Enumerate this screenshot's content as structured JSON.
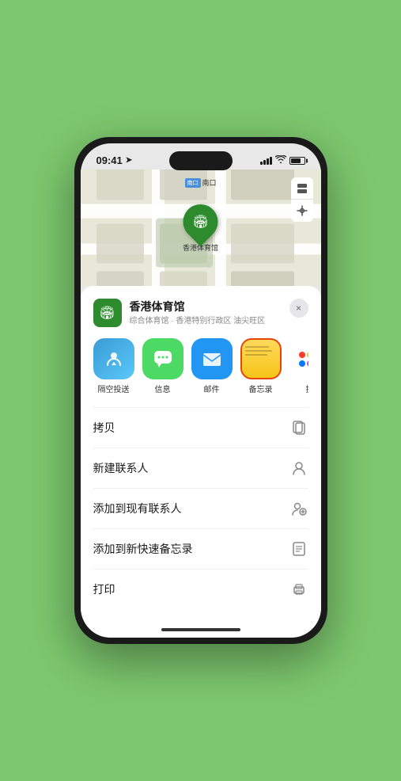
{
  "status_bar": {
    "time": "09:41",
    "location_arrow": "▲"
  },
  "map": {
    "entrance_tag": "南口",
    "pin_label": "香港体育馆"
  },
  "venue": {
    "name": "香港体育馆",
    "subtitle": "综合体育馆 · 香港特别行政区 油尖旺区",
    "close_label": "×"
  },
  "share_items": [
    {
      "id": "airdrop",
      "label": "隔空投送",
      "type": "airdrop"
    },
    {
      "id": "messages",
      "label": "信息",
      "type": "messages"
    },
    {
      "id": "mail",
      "label": "邮件",
      "type": "mail"
    },
    {
      "id": "notes",
      "label": "备忘录",
      "type": "notes"
    },
    {
      "id": "more",
      "label": "提",
      "type": "more"
    }
  ],
  "actions": [
    {
      "id": "copy",
      "label": "拷贝",
      "icon": "copy"
    },
    {
      "id": "new-contact",
      "label": "新建联系人",
      "icon": "person"
    },
    {
      "id": "add-contact",
      "label": "添加到现有联系人",
      "icon": "person-add"
    },
    {
      "id": "quick-note",
      "label": "添加到新快速备忘录",
      "icon": "note"
    },
    {
      "id": "print",
      "label": "打印",
      "icon": "print"
    }
  ]
}
